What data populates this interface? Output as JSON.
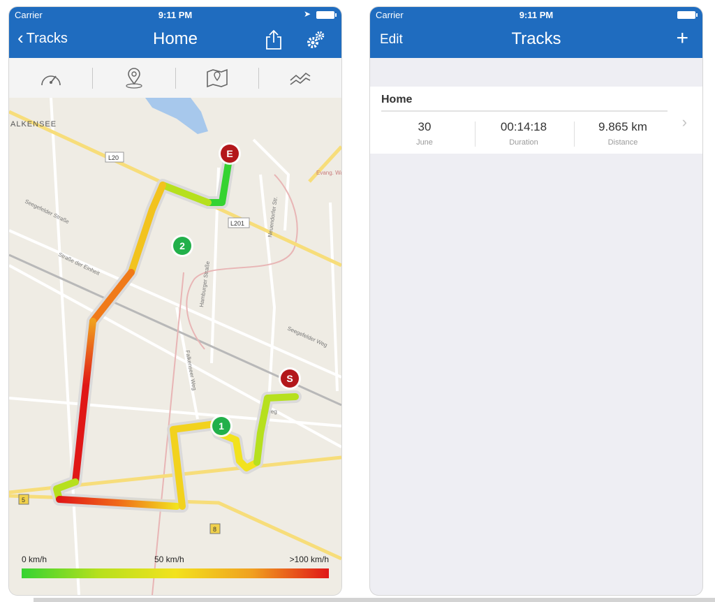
{
  "status": {
    "carrier": "Carrier",
    "time": "9:11 PM"
  },
  "left": {
    "back_label": "Tracks",
    "title": "Home",
    "toolbar": [
      {
        "name": "speedometer-icon"
      },
      {
        "name": "map-pin-icon"
      },
      {
        "name": "map-icon"
      },
      {
        "name": "chart-icon"
      }
    ],
    "map_labels": {
      "town": "ALKENSEE",
      "road_l20": "L20",
      "road_l201": "L201",
      "road_5": "5",
      "road_8": "8",
      "street_seegefelder_1": "Seegefelder Straße",
      "street_einheit": "Straße der Einheit",
      "street_hamburger": "Hamburger Straße",
      "street_neuendorfer": "Neuendorfer Str.",
      "street_seegefelder_2": "Seegefelder Weg",
      "street_falkenseer": "Falkenseer Weg",
      "street_torweg": "Torweg",
      "poi_evang": "Evang. Waldkirche"
    },
    "markers": {
      "end": "E",
      "start": "S",
      "lap1": "1",
      "lap2": "2"
    },
    "legend": {
      "min": "0 km/h",
      "mid": "50 km/h",
      "max": ">100 km/h"
    },
    "colors": {
      "slow": "#35d331",
      "mid": "#f2e21e",
      "fast": "#e01717",
      "navbar": "#1f6cbf"
    }
  },
  "right": {
    "edit_label": "Edit",
    "title": "Tracks",
    "add_label": "+",
    "track": {
      "name": "Home",
      "date_value": "30",
      "date_caption": "June",
      "duration_value": "00:14:18",
      "duration_caption": "Duration",
      "distance_value": "9.865 km",
      "distance_caption": "Distance"
    }
  }
}
